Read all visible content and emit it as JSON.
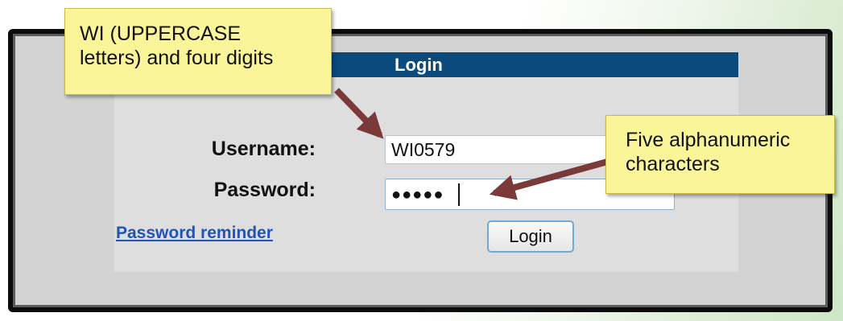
{
  "login_header": {
    "title": "Login"
  },
  "form": {
    "username_label": "Username:",
    "username_value": "WI0579",
    "password_label": "Password:",
    "password_value": "●●●●●",
    "reminder_link": "Password reminder",
    "login_button": "Login"
  },
  "annotations": {
    "username_note_line1": "WI (UPPERCASE",
    "username_note_line2": "letters) and four digits",
    "password_note_line1": "Five alphanumeric",
    "password_note_line2": "characters"
  },
  "colors": {
    "header_bar": "#0a4a7d",
    "callout_fill": "#fbf59a",
    "arrow": "#7a3a3a",
    "link": "#1f54b8"
  }
}
